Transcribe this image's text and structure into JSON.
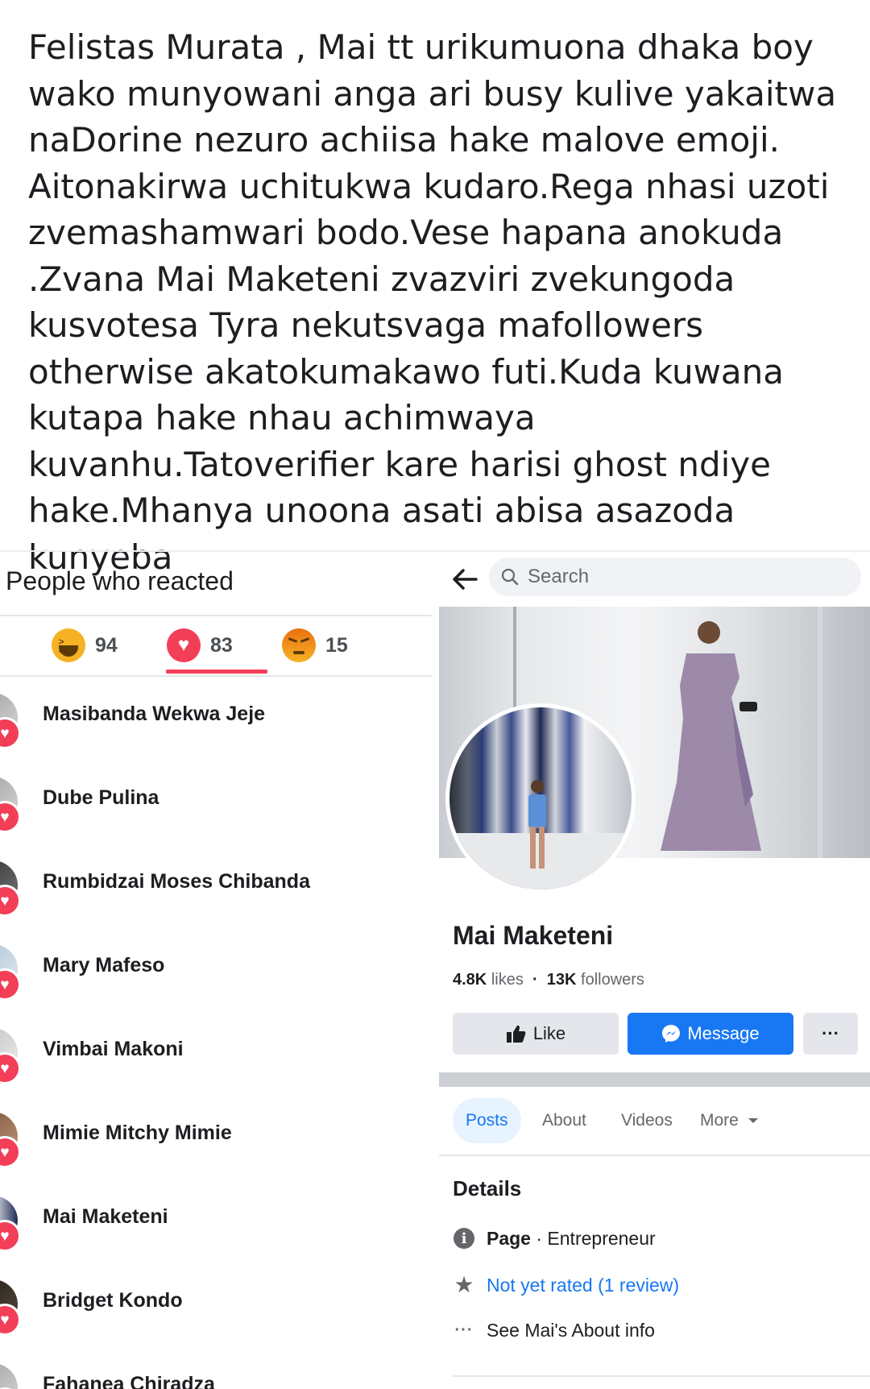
{
  "post": {
    "text": "Felistas Murata , Mai tt urikumuona dhaka boy wako munyowani anga ari busy kulive yakaitwa naDorine nezuro achiisa hake malove emoji. Aitonakirwa uchitukwa kudaro.Rega nhasi uzoti zvemashamwari bodo.Vese hapana anokuda .Zvana Mai Maketeni zvazviri zvekungoda kusvotesa Tyra nekutsvaga mafollowers otherwise akatokumakawo futi.Kuda kuwana kutapa hake nhau achimwaya kuvanhu.Tatoverifier kare harisi ghost ndiye hake.Mhanya unoona asati abisa asazoda kunyeba"
  },
  "reactions": {
    "title": "People who reacted",
    "tabs": [
      {
        "icon": "haha-emoji-icon",
        "count": "94"
      },
      {
        "icon": "love-emoji-icon",
        "count": "83"
      },
      {
        "icon": "angry-emoji-icon",
        "count": "15"
      }
    ],
    "active_tab": "love",
    "people": [
      {
        "name": "Masibanda Wekwa Jeje"
      },
      {
        "name": "Dube Pulina"
      },
      {
        "name": "Rumbidzai Moses Chibanda"
      },
      {
        "name": "Mary Mafeso"
      },
      {
        "name": "Vimbai Makoni"
      },
      {
        "name": "Mimie Mitchy Mimie"
      },
      {
        "name": "Mai Maketeni"
      },
      {
        "name": "Bridget Kondo"
      },
      {
        "name": "Fahanea Chiradza"
      }
    ]
  },
  "profile": {
    "search_placeholder": "Search",
    "page_name": "Mai Maketeni",
    "likes_count": "4.8K",
    "likes_label": "likes",
    "separator": "·",
    "followers_count": "13K",
    "followers_label": "followers",
    "buttons": {
      "like": "Like",
      "message": "Message",
      "more": "···"
    },
    "tabs": [
      "Posts",
      "About",
      "Videos",
      "More"
    ],
    "active_tab": "Posts",
    "details_title": "Details",
    "details": {
      "page_label": "Page",
      "page_category": "· Entrepreneur",
      "rating": "Not yet rated (1 review)",
      "about_link": "See Mai's About info"
    },
    "colors": {
      "accent": "#1877f2",
      "love": "#f33e58",
      "haha": "#f7b125"
    }
  }
}
